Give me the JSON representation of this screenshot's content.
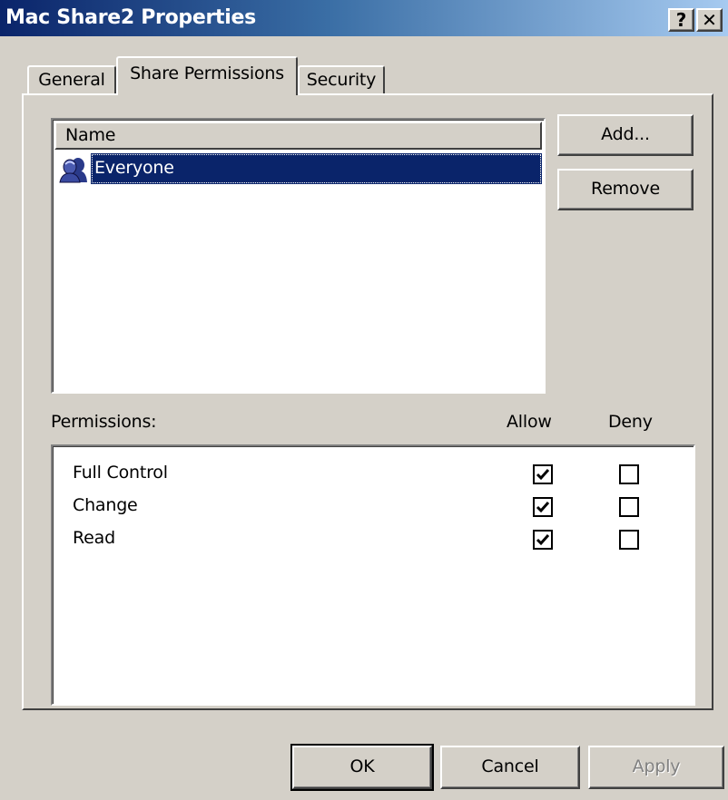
{
  "window": {
    "title": "Mac Share2 Properties",
    "help_label": "?",
    "close_label": "✕"
  },
  "tabs": [
    {
      "label": "General",
      "active": false
    },
    {
      "label": "Share Permissions",
      "active": true
    },
    {
      "label": "Security",
      "active": false
    }
  ],
  "users": {
    "column_header": "Name",
    "items": [
      {
        "name": "Everyone",
        "icon": "group-icon",
        "selected": true
      }
    ]
  },
  "buttons": {
    "add": "Add...",
    "remove": "Remove",
    "ok": "OK",
    "cancel": "Cancel",
    "apply": "Apply"
  },
  "permissions": {
    "label": "Permissions:",
    "allow_label": "Allow",
    "deny_label": "Deny",
    "rows": [
      {
        "name": "Full Control",
        "allow": true,
        "deny": false
      },
      {
        "name": "Change",
        "allow": true,
        "deny": false
      },
      {
        "name": "Read",
        "allow": true,
        "deny": false
      }
    ]
  },
  "colors": {
    "titlebar_start": "#0a246a",
    "titlebar_end": "#a6caf0",
    "face": "#d4d0c8",
    "selection": "#0a246a",
    "disabled_text": "#808080"
  }
}
